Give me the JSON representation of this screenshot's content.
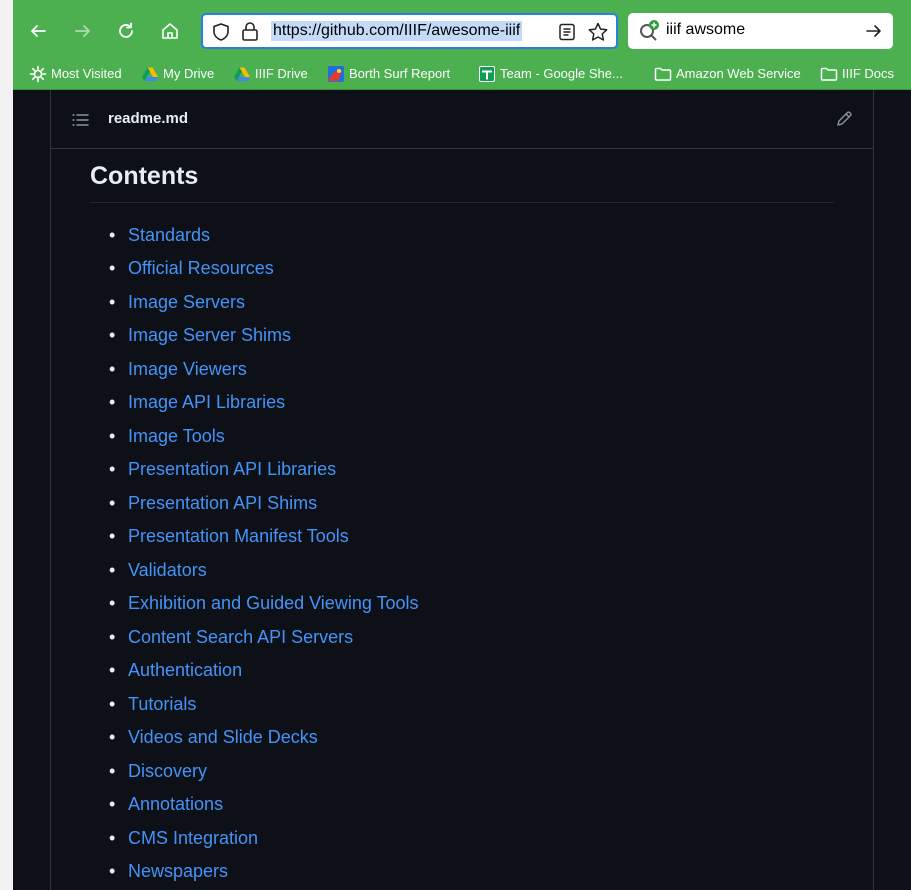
{
  "browser": {
    "url": "https://github.com/IIIF/awesome-iiif",
    "search_query": "iiif awsome",
    "bookmarks": [
      {
        "label": "Most Visited",
        "icon": "gear-icon"
      },
      {
        "label": "My Drive",
        "icon": "google-drive-icon"
      },
      {
        "label": "IIIF Drive",
        "icon": "google-drive-icon"
      },
      {
        "label": "Borth Surf Report",
        "icon": "surf-report-icon"
      },
      {
        "label": "Team - Google She...",
        "icon": "google-sheets-icon"
      },
      {
        "label": "Amazon Web Service",
        "icon": "folder-icon"
      },
      {
        "label": "IIIF Docs",
        "icon": "folder-icon"
      }
    ]
  },
  "readme": {
    "file_name": "readme.md",
    "heading": "Contents",
    "toc": [
      "Standards",
      "Official Resources",
      "Image Servers",
      "Image Server Shims",
      "Image Viewers",
      "Image API Libraries",
      "Image Tools",
      "Presentation API Libraries",
      "Presentation API Shims",
      "Presentation Manifest Tools",
      "Validators",
      "Exhibition and Guided Viewing Tools",
      "Content Search API Servers",
      "Authentication",
      "Tutorials",
      "Videos and Slide Decks",
      "Discovery",
      "Annotations",
      "CMS Integration",
      "Newspapers"
    ]
  },
  "colors": {
    "toolbar": "#4caf50",
    "page_background": "#0d1117",
    "link": "#4493f8",
    "text": "#e6edf3",
    "border": "#30363d"
  }
}
